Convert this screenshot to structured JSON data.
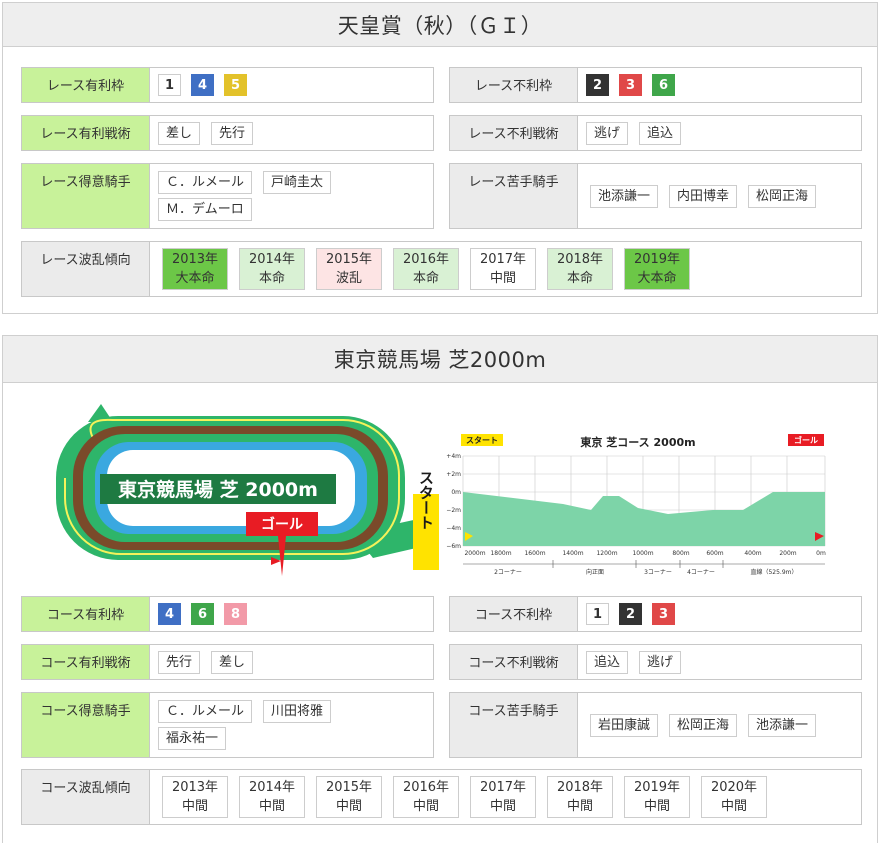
{
  "race": {
    "title": "天皇賞（秋）（ＧＩ）",
    "favorable_gate": {
      "label": "レース有利枠",
      "gates": [
        "1",
        "4",
        "5"
      ]
    },
    "unfavorable_gate": {
      "label": "レース不利枠",
      "gates": [
        "2",
        "3",
        "6"
      ]
    },
    "favorable_tactics": {
      "label": "レース有利戦術",
      "items": [
        "差し",
        "先行"
      ]
    },
    "unfavorable_tactics": {
      "label": "レース不利戦術",
      "items": [
        "逃げ",
        "追込"
      ]
    },
    "good_jockeys": {
      "label": "レース得意騎手",
      "items": [
        "Ｃ．ルメール",
        "戸崎圭太",
        "Ｍ．デムーロ"
      ]
    },
    "bad_jockeys": {
      "label": "レース苦手騎手",
      "items": [
        "池添謙一",
        "内田博幸",
        "松岡正海"
      ]
    },
    "upset_trend": {
      "label": "レース波乱傾向",
      "years": [
        {
          "year": "2013年",
          "result": "大本命"
        },
        {
          "year": "2014年",
          "result": "本命"
        },
        {
          "year": "2015年",
          "result": "波乱"
        },
        {
          "year": "2016年",
          "result": "本命"
        },
        {
          "year": "2017年",
          "result": "中間"
        },
        {
          "year": "2018年",
          "result": "本命"
        },
        {
          "year": "2019年",
          "result": "大本命"
        }
      ]
    }
  },
  "course": {
    "title": "東京競馬場 芝2000m",
    "map": {
      "name_label": "東京競馬場 芝 2000m",
      "goal_label": "ゴール",
      "start_label": "スタート"
    },
    "profile": {
      "title": "東京 芝コース 2000m",
      "start_badge": "スタート",
      "goal_badge": "ゴール",
      "y_ticks": [
        "+4m",
        "+2m",
        "0m",
        "−2m",
        "−4m",
        "−6m"
      ],
      "x_ticks": [
        "2000m",
        "1800m",
        "1600m",
        "1400m",
        "1200m",
        "1000m",
        "800m",
        "600m",
        "400m",
        "200m",
        "0m"
      ],
      "sections": [
        "2コーナー",
        "向正面",
        "3コーナー",
        "4コーナー",
        "直線（525.9m）"
      ]
    },
    "favorable_gate": {
      "label": "コース有利枠",
      "gates": [
        "4",
        "6",
        "8"
      ]
    },
    "unfavorable_gate": {
      "label": "コース不利枠",
      "gates": [
        "1",
        "2",
        "3"
      ]
    },
    "favorable_tactics": {
      "label": "コース有利戦術",
      "items": [
        "先行",
        "差し"
      ]
    },
    "unfavorable_tactics": {
      "label": "コース不利戦術",
      "items": [
        "追込",
        "逃げ"
      ]
    },
    "good_jockeys": {
      "label": "コース得意騎手",
      "items": [
        "Ｃ．ルメール",
        "川田将雅",
        "福永祐一"
      ]
    },
    "bad_jockeys": {
      "label": "コース苦手騎手",
      "items": [
        "岩田康誠",
        "松岡正海",
        "池添謙一"
      ]
    },
    "upset_trend": {
      "label": "コース波乱傾向",
      "years": [
        {
          "year": "2013年",
          "result": "中間"
        },
        {
          "year": "2014年",
          "result": "中間"
        },
        {
          "year": "2015年",
          "result": "中間"
        },
        {
          "year": "2016年",
          "result": "中間"
        },
        {
          "year": "2017年",
          "result": "中間"
        },
        {
          "year": "2018年",
          "result": "中間"
        },
        {
          "year": "2019年",
          "result": "中間"
        },
        {
          "year": "2020年",
          "result": "中間"
        }
      ]
    }
  },
  "colors": {
    "gate_1": "#ffffff",
    "gate_2": "#333333",
    "gate_3": "#e04848",
    "gate_4": "#3f6fc4",
    "gate_5": "#e3c22a",
    "gate_6": "#3fa64a",
    "gate_7": "#f09a3a",
    "gate_8": "#f29aa8",
    "good_label_bg": "#c8f29a",
    "track_green": "#2eb56a",
    "profile_fill": "#7dd4a8"
  }
}
